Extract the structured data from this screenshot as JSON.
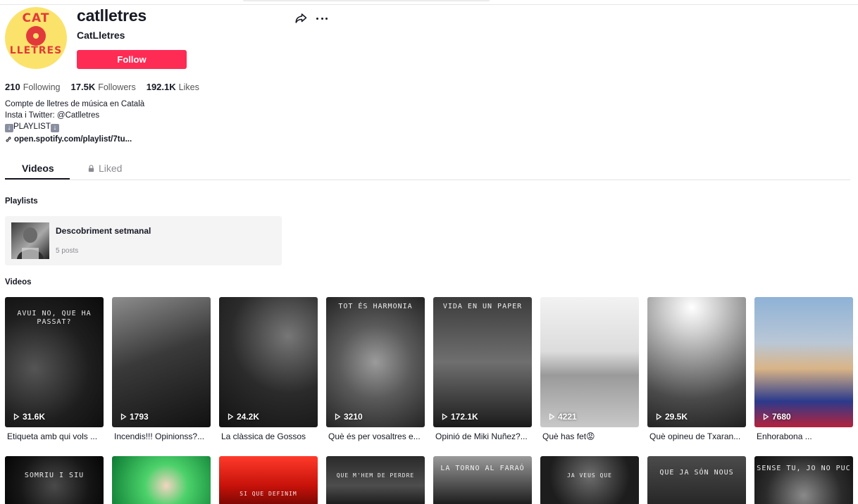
{
  "profile": {
    "username": "catlletres",
    "nickname": "CatLletres",
    "follow_label": "Follow",
    "avatar_text_top": "CAT",
    "avatar_text_bottom": "LLETRES",
    "avatar_icon": "vinyl-record-logo"
  },
  "stats": [
    {
      "value": "210",
      "label": "Following"
    },
    {
      "value": "17.5K",
      "label": "Followers"
    },
    {
      "value": "192.1K",
      "label": "Likes"
    }
  ],
  "bio": {
    "line1": "Compte de lletres de música en Català",
    "line2": "Insta i Twitter: @Catlletres",
    "line3": "PLAYLIST",
    "link": "open.spotify.com/playlist/7tu..."
  },
  "tabs": {
    "videos": "Videos",
    "liked": "Liked"
  },
  "sections": {
    "playlists": "Playlists",
    "videos": "Videos"
  },
  "playlist": {
    "name": "Descobriment setmanal",
    "count": "5 posts"
  },
  "videos_row1": [
    {
      "views": "31.6K",
      "caption": "Etiqueta amb qui vols ...",
      "overlay": "AVUI NO, QUE HA PASSAT?"
    },
    {
      "views": "1793",
      "caption": "Incendis!!! Opinionss?...",
      "overlay": ""
    },
    {
      "views": "24.2K",
      "caption": "La clàssica de Gossos",
      "overlay": ""
    },
    {
      "views": "3210",
      "caption": "Què és per vosaltres e...",
      "overlay": "TOT ÉS HARMONIA"
    },
    {
      "views": "172.1K",
      "caption": "Opinió de Miki Nuñez?...",
      "overlay": "VIDA EN UN PAPER"
    },
    {
      "views": "4221",
      "caption": "Què has fet😡",
      "overlay": ""
    },
    {
      "views": "29.5K",
      "caption": "Què opineu de Txaran...",
      "overlay": ""
    },
    {
      "views": "7680",
      "caption": "Enhorabona ...",
      "overlay": ""
    }
  ],
  "videos_row2": [
    {
      "overlay": "SOMRIU I SIU"
    },
    {
      "overlay": ""
    },
    {
      "overlay": "SI QUE DEFINIM"
    },
    {
      "overlay": "QUE M'HEM DE PERDRE"
    },
    {
      "overlay": "LA TORNO AL FARAÓ"
    },
    {
      "overlay": "JA VEUS QUE"
    },
    {
      "overlay": "QUE JA SÓN NOUS"
    },
    {
      "overlay": "SENSE TU, JO NO PUC"
    }
  ],
  "colors": {
    "accent": "#fe2c55",
    "avatar_bg": "#fbe36b",
    "avatar_logo": "#e23a3a",
    "text": "#161823",
    "muted": "#8a8b91"
  }
}
